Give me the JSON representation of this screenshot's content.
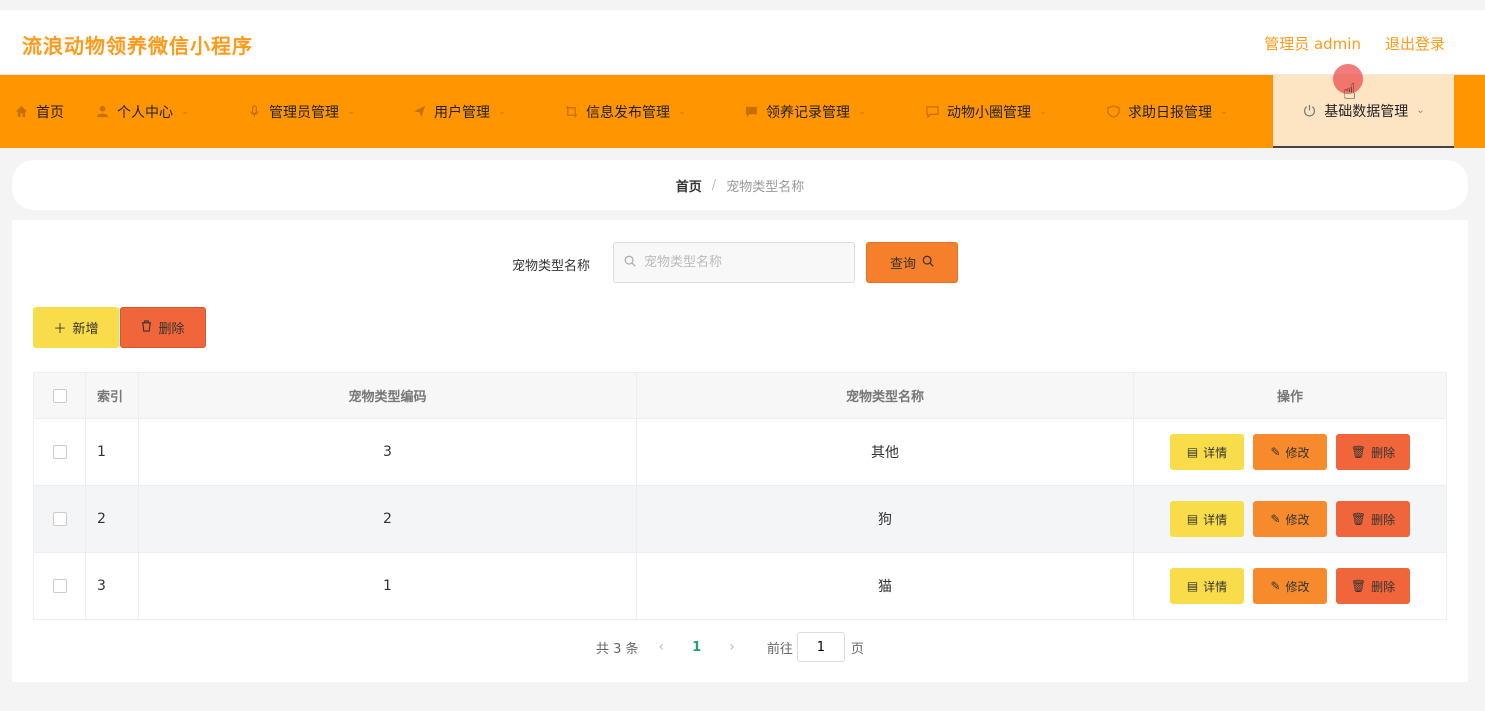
{
  "header": {
    "app_title": "流浪动物领养微信小程序",
    "admin_label": "管理员 admin",
    "logout": "退出登录"
  },
  "nav": {
    "items": [
      {
        "label": "首页",
        "icon": "home-icon",
        "has_arrow": false
      },
      {
        "label": "个人中心",
        "icon": "user-icon",
        "has_arrow": true
      },
      {
        "label": "管理员管理",
        "icon": "mic-icon",
        "has_arrow": true
      },
      {
        "label": "用户管理",
        "icon": "send-icon",
        "has_arrow": true
      },
      {
        "label": "信息发布管理",
        "icon": "crop-icon",
        "has_arrow": true
      },
      {
        "label": "领养记录管理",
        "icon": "message-icon",
        "has_arrow": true
      },
      {
        "label": "动物小圈管理",
        "icon": "chat-icon",
        "has_arrow": true
      },
      {
        "label": "求助日报管理",
        "icon": "help-icon",
        "has_arrow": true
      },
      {
        "label": "基础数据管理",
        "icon": "power-icon",
        "has_arrow": true,
        "active": true
      }
    ]
  },
  "breadcrumb": {
    "home": "首页",
    "separator": "/",
    "current": "宠物类型名称"
  },
  "search": {
    "label": "宠物类型名称",
    "placeholder": "宠物类型名称",
    "value": "",
    "query_button": "查询"
  },
  "toolbar": {
    "add_label": "新增",
    "delete_label": "删除"
  },
  "table": {
    "headers": {
      "index": "索引",
      "code": "宠物类型编码",
      "name": "宠物类型名称",
      "ops": "操作"
    },
    "rows": [
      {
        "index": "1",
        "code": "3",
        "name": "其他"
      },
      {
        "index": "2",
        "code": "2",
        "name": "狗"
      },
      {
        "index": "3",
        "code": "1",
        "name": "猫"
      }
    ],
    "op_labels": {
      "detail": "详情",
      "edit": "修改",
      "delete": "删除"
    }
  },
  "pager": {
    "total_text": "共 3 条",
    "current_page": "1",
    "goto_prefix": "前往",
    "goto_value": "1",
    "goto_suffix": "页"
  },
  "colors": {
    "accent": "#ff9500",
    "title": "#ff9a1a",
    "active_nav_bg": "#fde5c4",
    "yellow_btn": "#f9dc4a",
    "orange_btn": "#f78a2c",
    "red_btn": "#f0663a"
  }
}
